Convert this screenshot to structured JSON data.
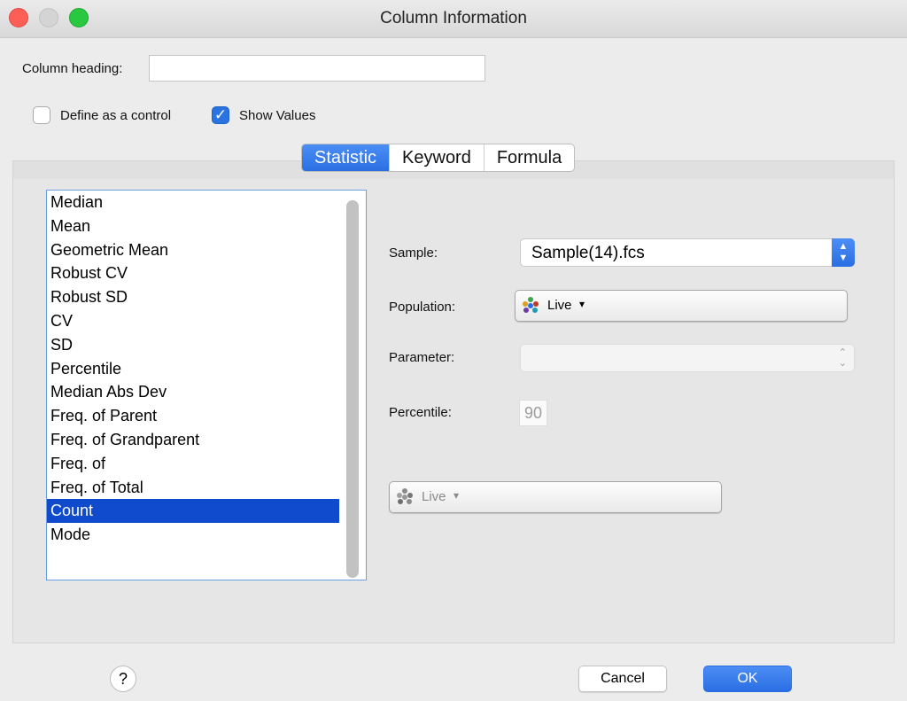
{
  "window": {
    "title": "Column Information"
  },
  "heading": {
    "label": "Column heading:",
    "value": ""
  },
  "checkboxes": {
    "control_label": "Define as a control",
    "control_checked": false,
    "show_values_label": "Show Values",
    "show_values_checked": true
  },
  "tabs": [
    {
      "label": "Statistic",
      "active": true
    },
    {
      "label": "Keyword",
      "active": false
    },
    {
      "label": "Formula",
      "active": false
    }
  ],
  "statistics": {
    "items": [
      "Median",
      "Mean",
      "Geometric Mean",
      "Robust CV",
      "Robust SD",
      "CV",
      "SD",
      "Percentile",
      "Median Abs Dev",
      "Freq. of Parent",
      "Freq. of Grandparent",
      "Freq. of",
      "Freq. of Total",
      "Count",
      "Mode"
    ],
    "selected": "Count"
  },
  "form": {
    "sample_label": "Sample:",
    "sample_value": "Sample(14).fcs",
    "population_label": "Population:",
    "population_value": "Live",
    "parameter_label": "Parameter:",
    "parameter_value": "",
    "percentile_label": "Percentile:",
    "percentile_value": "90",
    "secondary_population_value": "Live"
  },
  "buttons": {
    "help": "?",
    "cancel": "Cancel",
    "ok": "OK"
  },
  "colors": {
    "accent": "#2a6ee3",
    "selection": "#0f4bcc",
    "close": "#fd5f57",
    "zoom": "#28c840"
  },
  "icons": {
    "population": "population-dots-icon",
    "dropdown": "caret-down-icon",
    "stepper": "up-down-chevron-icon"
  }
}
